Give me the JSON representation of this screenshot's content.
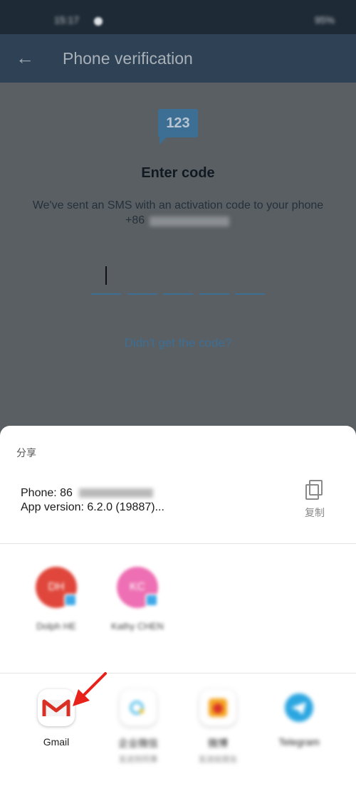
{
  "status_bar": {
    "time": "15:17",
    "system": "95%"
  },
  "app_bar": {
    "title": "Phone verification"
  },
  "verification": {
    "icon_text": "123",
    "heading": "Enter code",
    "description": "We've sent an SMS with an activation code to your phone",
    "phone_prefix": "+86",
    "resend_link": "Didn't get the code?"
  },
  "share_sheet": {
    "title": "分享",
    "preview_line1": "Phone: 86",
    "preview_line2": "App version: 6.2.0 (19887)...",
    "copy_label": "复制",
    "contacts": [
      {
        "initials": "DH",
        "name": "Dolph HE",
        "color": "#e0463b"
      },
      {
        "initials": "KC",
        "name": "Kathy CHEN",
        "color": "#ee6fb3"
      }
    ],
    "apps": [
      {
        "label": "Gmail",
        "sub": ""
      },
      {
        "label": "企业微信",
        "sub": "发送到同事"
      },
      {
        "label": "微博",
        "sub": "发送给朋友"
      },
      {
        "label": "Telegram",
        "sub": ""
      }
    ]
  },
  "colors": {
    "accent": "#3d6e94",
    "arrow": "#e8211b"
  }
}
